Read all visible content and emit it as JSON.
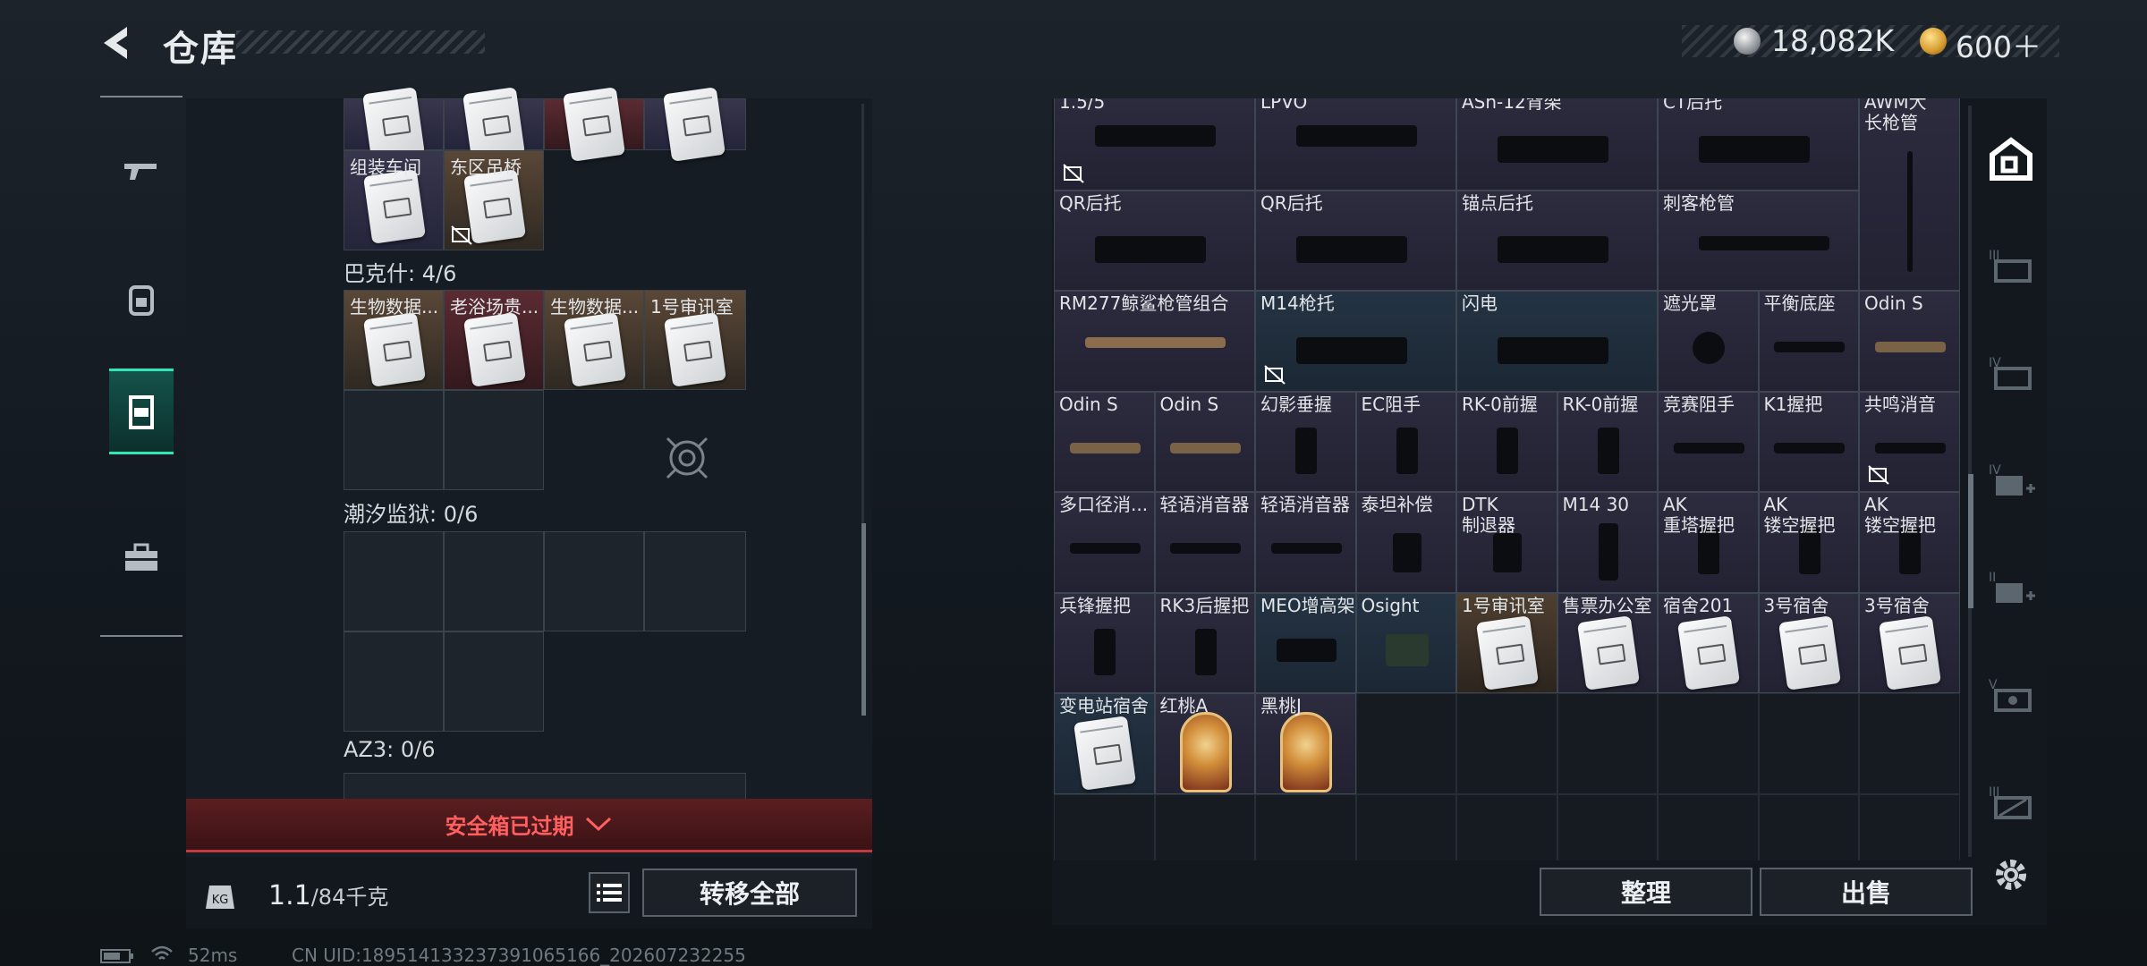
{
  "header": {
    "title": "仓库",
    "currency_silver": "18,082K",
    "currency_gold": "600＋",
    "colors": {
      "silver": "#c8ccd0",
      "gold": "#d9a43b"
    }
  },
  "nav": {
    "items": [
      {
        "icon": "rifle-icon"
      },
      {
        "icon": "backpack-icon"
      },
      {
        "icon": "chest-rig-icon",
        "active": true
      },
      {
        "icon": "toolbox-icon"
      }
    ],
    "active_color": "#2fe6b9"
  },
  "left": {
    "top_slots": [
      "组装车间",
      "东区吊桥"
    ],
    "sections": [
      {
        "label": "巴克什: 4/6",
        "slots": [
          "生物数据...",
          "老浴场贵...",
          "生物数据...",
          "1号审讯室"
        ]
      },
      {
        "label": "潮汐监狱: 0/6"
      },
      {
        "label": "AZ3: 0/6"
      }
    ],
    "warning": "安全箱已过期",
    "weight_value": "1.1",
    "weight_max": "/84千克",
    "transfer_button": "转移全部"
  },
  "right": {
    "rows": [
      [
        "1.5/5",
        "LPVO",
        "ASh-12背架",
        "CT后托",
        "AWM大\n长枪管"
      ],
      [
        "QR后托",
        "QR后托",
        "锚点后托",
        "刺客枪管"
      ],
      [
        "RM277鲸鲨枪管组合",
        "M14枪托",
        "闪电",
        "遮光罩",
        "平衡底座",
        "Odin S"
      ],
      [
        "Odin S",
        "Odin S",
        "幻影垂握",
        "EC阻手",
        "RK-0前握",
        "RK-0前握",
        "竞赛阻手",
        "K1握把",
        "共鸣消音"
      ],
      [
        "多口径消...",
        "轻语消音器",
        "轻语消音器",
        "泰坦补偿",
        "DTK\n制退器",
        "M14 30",
        "AK\n重塔握把",
        "AK\n镂空握把",
        "AK\n镂空握把"
      ],
      [
        "兵锋握把",
        "RK3后握把",
        "MEO增高架",
        "Osight",
        "1号审讯室",
        "售票办公室",
        "宿舍201",
        "3号宿舍",
        "3号宿舍"
      ],
      [
        "变电站宿舍",
        "红桃A",
        "黑桃J"
      ]
    ],
    "sort_button": "整理",
    "sell_button": "出售"
  },
  "sidebar": {
    "icons": [
      "home-storage-icon",
      "tier-3-storage-icon",
      "tier-4-storage-icon",
      "tier-4-add-icon",
      "tier-2-add-icon",
      "tier-5-storage-icon",
      "tier-3-alt-storage-icon",
      "settings-icon"
    ]
  },
  "status": {
    "ping": "52ms",
    "uid": "CN UID:1895141332373910651​66_202607232255"
  }
}
